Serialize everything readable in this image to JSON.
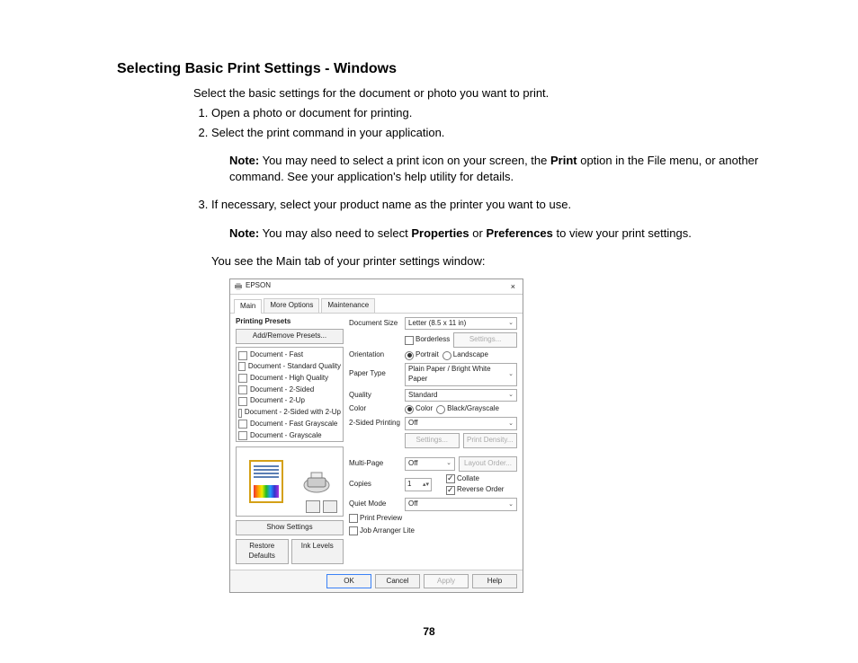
{
  "title": "Selecting Basic Print Settings - Windows",
  "intro": "Select the basic settings for the document or photo you want to print.",
  "steps": {
    "s1": "Open a photo or document for printing.",
    "s2": "Select the print command in your application.",
    "s3": "If necessary, select your product name as the printer you want to use."
  },
  "note1": {
    "prefix": "Note:",
    "a": " You may need to select a print icon on your screen, the ",
    "b": "Print",
    "c": " option in the File menu, or another command. See your application's help utility for details."
  },
  "note2": {
    "prefix": "Note:",
    "a": " You may also need to select ",
    "b": "Properties",
    "c": " or ",
    "d": "Preferences",
    "e": " to view your print settings."
  },
  "see_text": "You see the Main tab of your printer settings window:",
  "page_number": "78",
  "dialog": {
    "brand": "EPSON",
    "tabs": {
      "main": "Main",
      "more": "More Options",
      "maint": "Maintenance"
    },
    "presets_header": "Printing Presets",
    "add_remove": "Add/Remove Presets...",
    "presets": [
      "Document - Fast",
      "Document - Standard Quality",
      "Document - High Quality",
      "Document - 2-Sided",
      "Document - 2-Up",
      "Document - 2-Sided with 2-Up",
      "Document - Fast Grayscale",
      "Document - Grayscale"
    ],
    "show_settings": "Show Settings",
    "restore_defaults": "Restore Defaults",
    "ink_levels": "Ink Levels",
    "labels": {
      "doc_size": "Document Size",
      "borderless": "Borderless",
      "settings": "Settings...",
      "orientation": "Orientation",
      "portrait": "Portrait",
      "landscape": "Landscape",
      "paper_type": "Paper Type",
      "quality": "Quality",
      "color": "Color",
      "color_opt": "Color",
      "bw_opt": "Black/Grayscale",
      "twosided": "2-Sided Printing",
      "print_density": "Print Density...",
      "multipage": "Multi-Page",
      "layout_order": "Layout Order...",
      "copies": "Copies",
      "collate": "Collate",
      "reverse": "Reverse Order",
      "quiet": "Quiet Mode",
      "print_preview": "Print Preview",
      "job_arranger": "Job Arranger Lite"
    },
    "values": {
      "doc_size": "Letter (8.5 x 11 in)",
      "paper_type": "Plain Paper / Bright White Paper",
      "quality": "Standard",
      "twosided": "Off",
      "multipage": "Off",
      "copies": "1",
      "quiet": "Off"
    },
    "footer": {
      "ok": "OK",
      "cancel": "Cancel",
      "apply": "Apply",
      "help": "Help"
    }
  }
}
